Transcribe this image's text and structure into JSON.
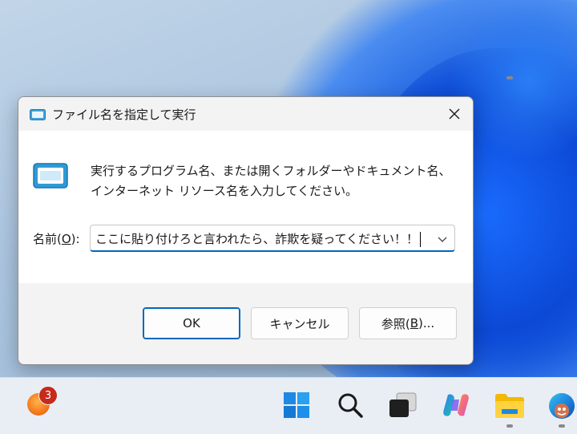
{
  "dialog": {
    "title": "ファイル名を指定して実行",
    "description": "実行するプログラム名、または開くフォルダーやドキュメント名、インターネット リソース名を入力してください。",
    "name_label_prefix": "名前(",
    "name_label_key": "O",
    "name_label_suffix": "):",
    "input_value": "ここに貼り付けろと言われたら、詐欺を疑ってください！！",
    "ok_label": "OK",
    "cancel_label": "キャンセル",
    "browse_prefix": "参照(",
    "browse_key": "B",
    "browse_suffix": ")..."
  },
  "taskbar": {
    "notification_count": "3",
    "items": [
      "weather-widget",
      "start",
      "search",
      "task-view",
      "copilot",
      "file-explorer",
      "edge"
    ]
  },
  "colors": {
    "accent": "#0067c0",
    "badge": "#c42b1c"
  }
}
